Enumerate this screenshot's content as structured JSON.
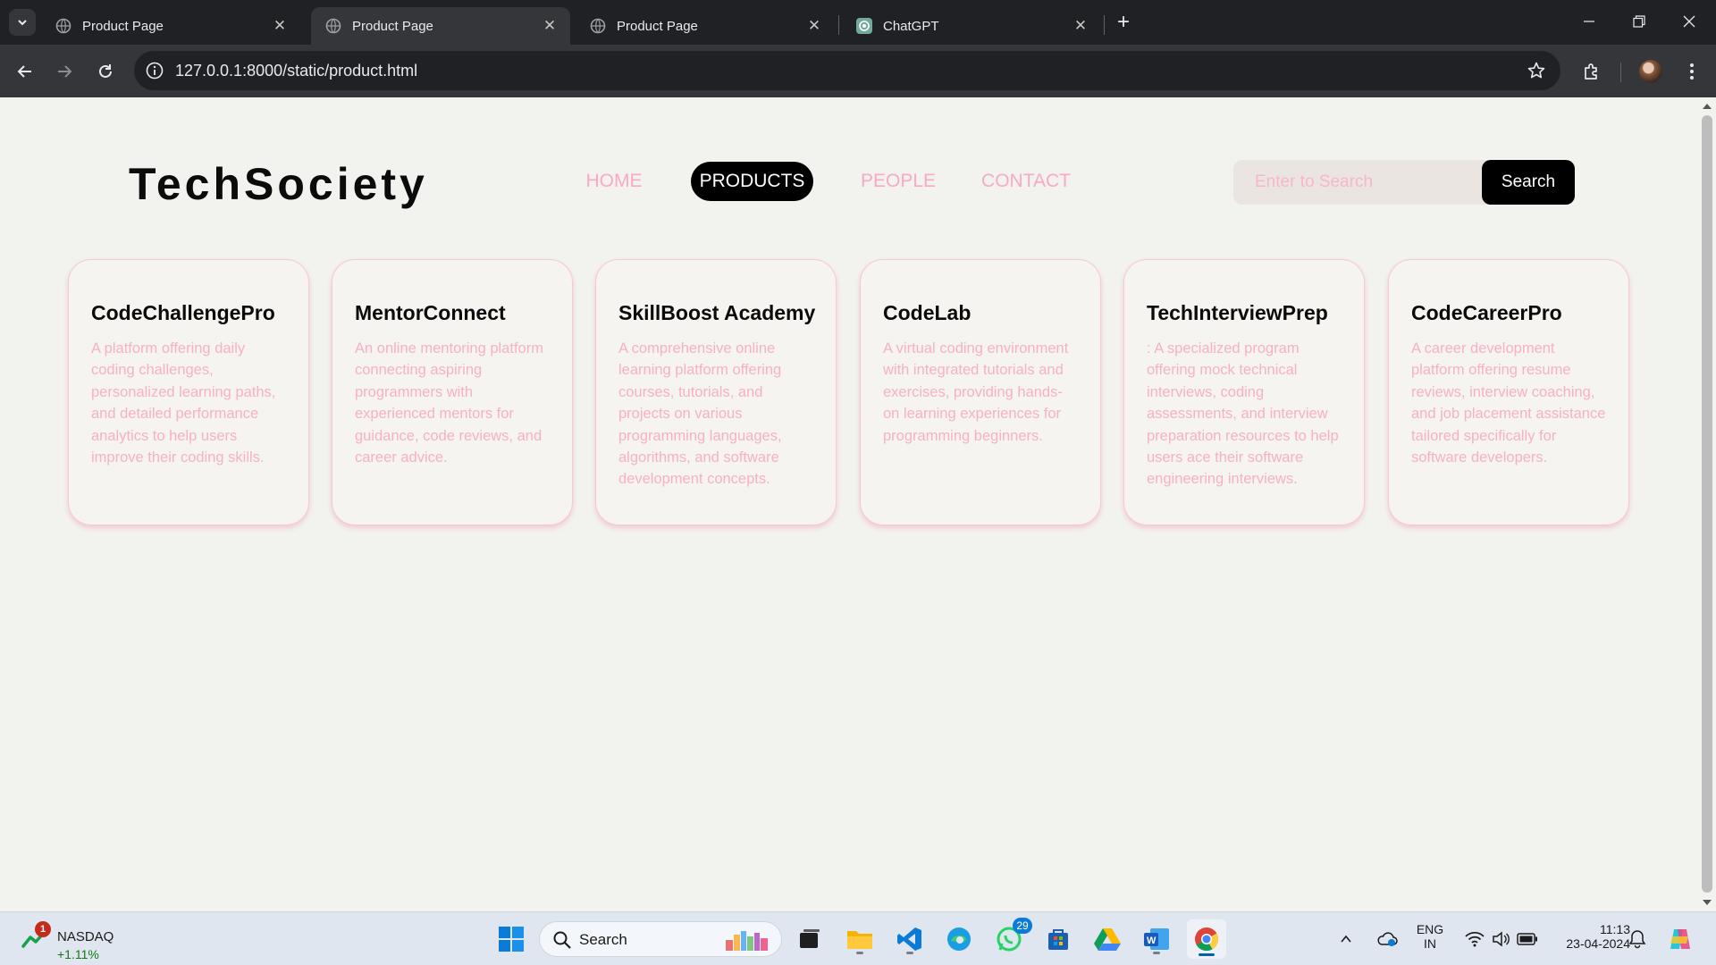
{
  "browser": {
    "tabs": [
      {
        "title": "Product Page",
        "active": false
      },
      {
        "title": "Product Page",
        "active": true
      },
      {
        "title": "Product Page",
        "active": false
      },
      {
        "title": "ChatGPT",
        "active": false
      }
    ],
    "url": "127.0.0.1:8000/static/product.html"
  },
  "site": {
    "logo": "TechSociety",
    "nav": [
      {
        "label": "HOME",
        "active": false
      },
      {
        "label": "PRODUCTS",
        "active": true
      },
      {
        "label": "PEOPLE",
        "active": false
      },
      {
        "label": "CONTACT",
        "active": false
      }
    ],
    "search": {
      "placeholder": "Enter to Search",
      "button_label": "Search"
    }
  },
  "products": [
    {
      "name": "CodeChallengePro",
      "description": "A platform offering daily coding challenges, personalized learning paths, and detailed performance analytics to help users improve their coding skills."
    },
    {
      "name": "MentorConnect",
      "description": "An online mentoring platform connecting aspiring programmers with experienced mentors for guidance, code reviews, and career advice."
    },
    {
      "name": "SkillBoost Academy",
      "description": "A comprehensive online learning platform offering courses, tutorials, and projects on various programming languages, algorithms, and software development concepts."
    },
    {
      "name": "CodeLab",
      "description": "A virtual coding environment with integrated tutorials and exercises, providing hands-on learning experiences for programming beginners."
    },
    {
      "name": "TechInterviewPrep",
      "description": ": A specialized program offering mock technical interviews, coding assessments, and interview preparation resources to help users ace their software engineering interviews."
    },
    {
      "name": "CodeCareerPro",
      "description": "A career development platform offering resume reviews, interview coaching, and job placement assistance tailored specifically for software developers."
    }
  ],
  "taskbar": {
    "widget": {
      "name": "NASDAQ",
      "change": "+1.11%",
      "badge": "1"
    },
    "search_label": "Search",
    "whatsapp_badge": "29",
    "language": {
      "line1": "ENG",
      "line2": "IN"
    },
    "time": "11:13",
    "date": "23-04-2024"
  },
  "colors": {
    "accent_pink": "#f8a9c3",
    "page_bg": "#f2f3ef",
    "button_black": "#000000"
  }
}
